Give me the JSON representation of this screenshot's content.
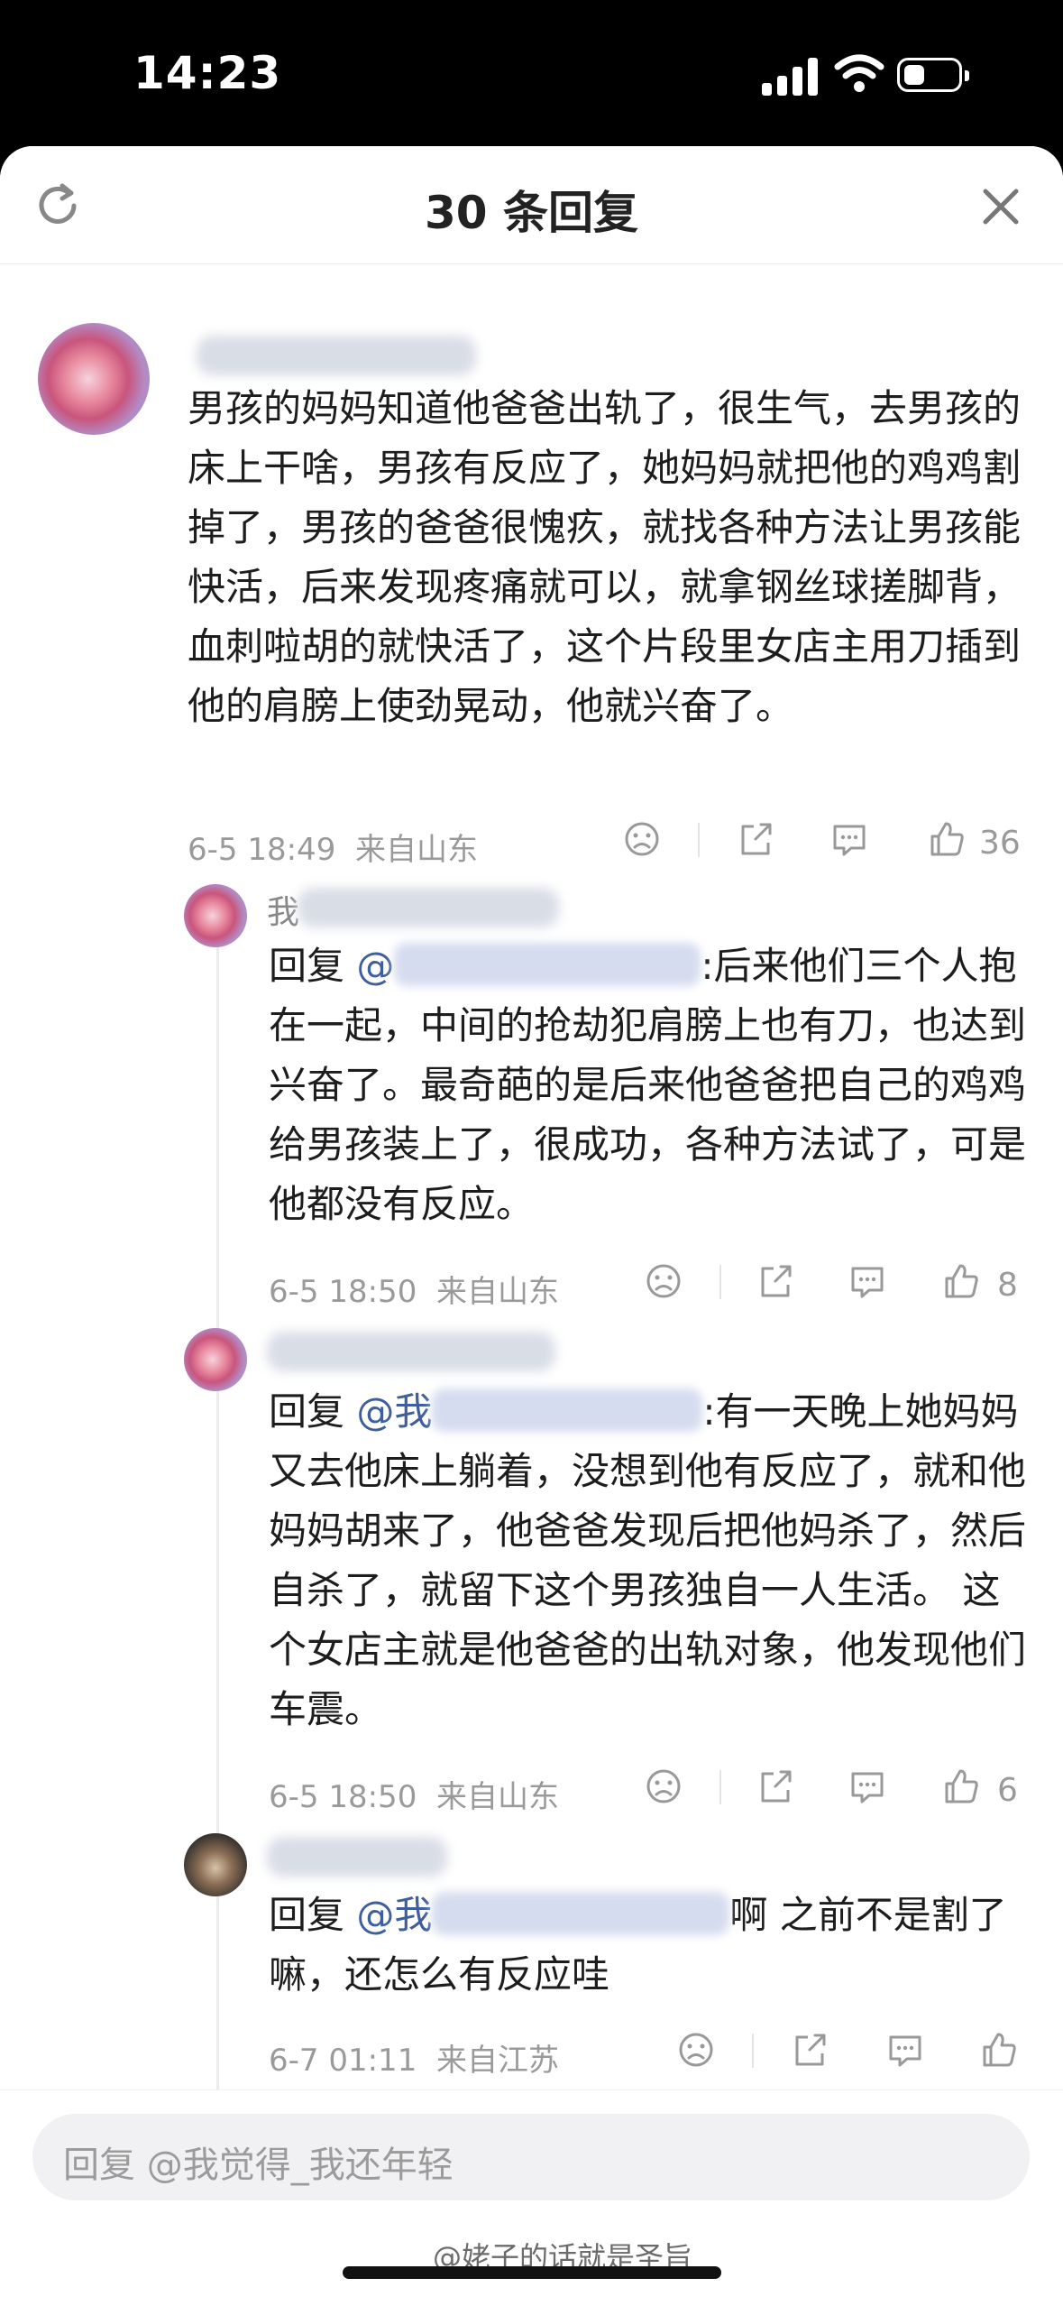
{
  "status": {
    "time": "14:23"
  },
  "header": {
    "title": "30 条回复",
    "refresh_icon": "refresh-icon",
    "close_icon": "close-icon"
  },
  "root": {
    "text": "男孩的妈妈知道他爸爸出轨了，很生气，去男孩的床上干啥，男孩有反应了，她妈妈就把他的鸡鸡割掉了，男孩的爸爸很愧疚，就找各种方法让男孩能快活，后来发现疼痛就可以，就拿钢丝球搓脚背，血刺啦胡的就快活了，这个片段里女店主用刀插到他的肩膀上使劲晃动，他就兴奋了。",
    "time": "6-5 18:49",
    "location": "来自山东",
    "likes": "36"
  },
  "replies": [
    {
      "name_stub": "我",
      "reply_prefix": "回复",
      "at": "@",
      "text": ":后来他们三个人抱在一起，中间的抢劫犯肩膀上也有刀，也达到兴奋了。最奇葩的是后来他爸爸把自己的鸡鸡给男孩装上了，很成功，各种方法试了，可是他都没有反应。",
      "time": "6-5 18:50",
      "location": "来自山东",
      "likes": "8"
    },
    {
      "name_stub": "",
      "reply_prefix": "回复",
      "at": "@",
      "at_tail": "我",
      "text": ":有一天晚上她妈妈又去他床上躺着，没想到他有反应了，就和他妈妈胡来了，他爸爸发现后把他妈杀了，然后自杀了，就留下这个男孩独自一人生活。 这个女店主就是他爸爸的出轨对象，他发现他们车震。",
      "time": "6-5 18:50",
      "location": "来自山东",
      "likes": "6"
    },
    {
      "name_stub": "",
      "reply_prefix": "回复",
      "at": "@",
      "at_tail": "我",
      "text": "啊  之前不是割了嘛，还怎么有反应哇",
      "time": "6-7 01:11",
      "location": "来自江苏",
      "likes": ""
    }
  ],
  "footer": {
    "placeholder": "回复 @我觉得_我还年轻",
    "watermark": "@姥子的话就是圣旨"
  },
  "colors": {
    "link": "#3f5e9e",
    "meta": "#9a9a9a",
    "text": "#1d1d1d"
  }
}
